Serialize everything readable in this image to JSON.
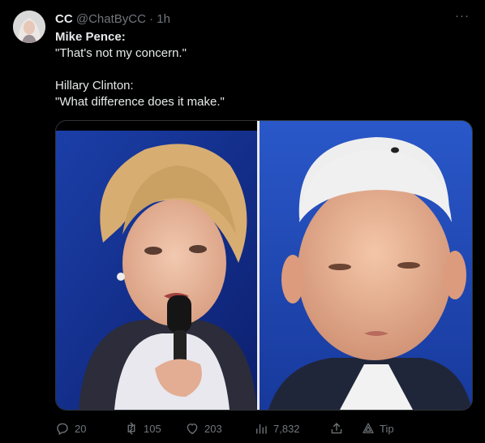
{
  "tweet": {
    "author_name": "CC",
    "handle": "@ChatByCC",
    "separator": "·",
    "time": "1h",
    "more_label": "···",
    "text_lines": {
      "line1": "Mike Pence:",
      "line2": "\"That's not my concern.\"",
      "line3": "Hillary Clinton:",
      "line4": "\"What difference does it make.\""
    }
  },
  "actions": {
    "replies": "20",
    "retweets": "105",
    "likes": "203",
    "views": "7,832",
    "tip_label": "Tip"
  },
  "colors": {
    "background": "#000000",
    "text": "#e7e9ea",
    "muted": "#71767b",
    "border": "#2f3336"
  }
}
